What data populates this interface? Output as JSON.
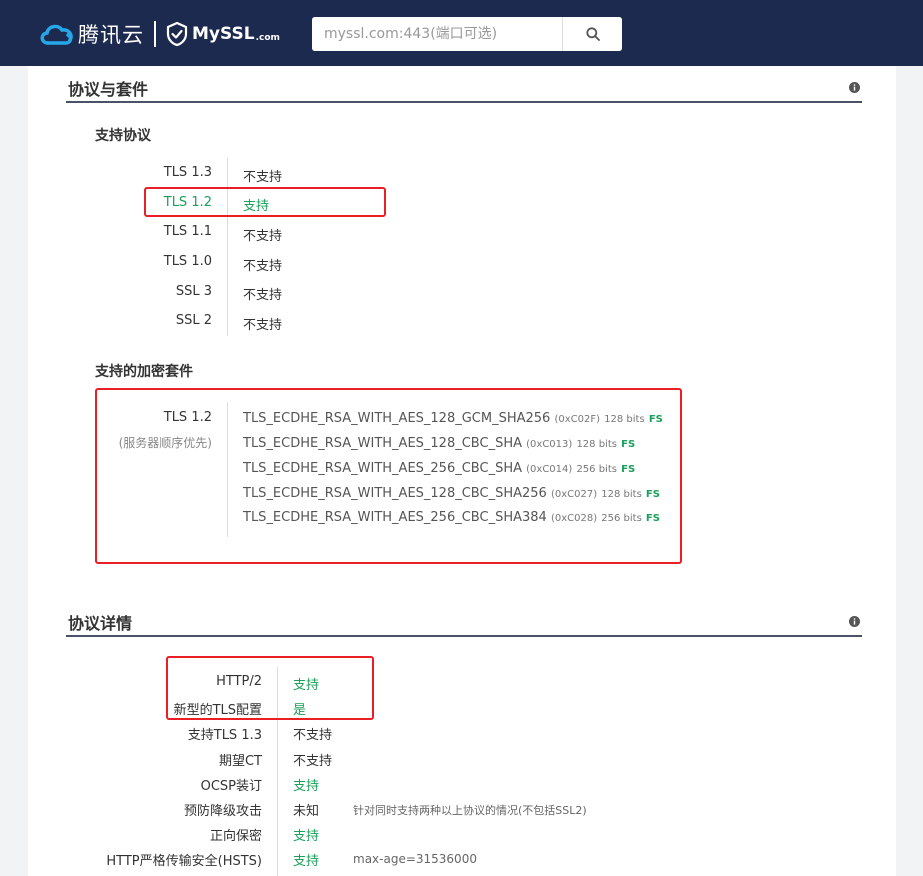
{
  "header": {
    "brand_name": "腾讯云",
    "myssl_name": "MySSL",
    "myssl_suffix": ".com",
    "search_placeholder": "myssl.com:443(端口可选)",
    "search_value": "",
    "search_icon": "magnifier-icon",
    "background_color": "#1d2a4f"
  },
  "protocol_section": {
    "title": "协议与套件",
    "info_icon": "info-icon",
    "supported_protocols_title": "支持协议",
    "protocols": [
      {
        "name": "TLS 1.3",
        "status": "不支持",
        "supported": false
      },
      {
        "name": "TLS 1.2",
        "status": "支持",
        "supported": true
      },
      {
        "name": "TLS 1.1",
        "status": "不支持",
        "supported": false
      },
      {
        "name": "TLS 1.0",
        "status": "不支持",
        "supported": false
      },
      {
        "name": "SSL 3",
        "status": "不支持",
        "supported": false
      },
      {
        "name": "SSL 2",
        "status": "不支持",
        "supported": false
      }
    ],
    "cipher_suites_title": "支持的加密套件",
    "cipher_group": {
      "protocol": "TLS 1.2",
      "order_note": "(服务器顺序优先)",
      "suites": [
        {
          "name": "TLS_ECDHE_RSA_WITH_AES_128_GCM_SHA256",
          "code": "(0xC02F)",
          "bits": "128 bits",
          "fs": "FS"
        },
        {
          "name": "TLS_ECDHE_RSA_WITH_AES_128_CBC_SHA",
          "code": "(0xC013)",
          "bits": "128 bits",
          "fs": "FS"
        },
        {
          "name": "TLS_ECDHE_RSA_WITH_AES_256_CBC_SHA",
          "code": "(0xC014)",
          "bits": "256 bits",
          "fs": "FS"
        },
        {
          "name": "TLS_ECDHE_RSA_WITH_AES_128_CBC_SHA256",
          "code": "(0xC027)",
          "bits": "128 bits",
          "fs": "FS"
        },
        {
          "name": "TLS_ECDHE_RSA_WITH_AES_256_CBC_SHA384",
          "code": "(0xC028)",
          "bits": "256 bits",
          "fs": "FS"
        }
      ]
    }
  },
  "details_section": {
    "title": "协议详情",
    "info_icon": "info-icon",
    "rows": [
      {
        "label": "HTTP/2",
        "value": "支持",
        "supported": true,
        "note": ""
      },
      {
        "label": "新型的TLS配置",
        "value": "是",
        "supported": true,
        "note": ""
      },
      {
        "label": "支持TLS 1.3",
        "value": "不支持",
        "supported": false,
        "note": ""
      },
      {
        "label": "期望CT",
        "value": "不支持",
        "supported": false,
        "note": ""
      },
      {
        "label": "OCSP装订",
        "value": "支持",
        "supported": true,
        "note": ""
      },
      {
        "label": "预防降级攻击",
        "value": "未知",
        "supported": false,
        "note": "针对同时支持两种以上协议的情况(不包括SSL2)"
      },
      {
        "label": "正向保密",
        "value": "支持",
        "supported": true,
        "note": ""
      },
      {
        "label": "HTTP严格传输安全(HSTS)",
        "value": "支持",
        "supported": true,
        "note": "max-age=31536000"
      }
    ]
  },
  "colors": {
    "supported_green": "#19a05a",
    "highlight_red": "#ea1e25",
    "section_rule": "#4a5268"
  }
}
